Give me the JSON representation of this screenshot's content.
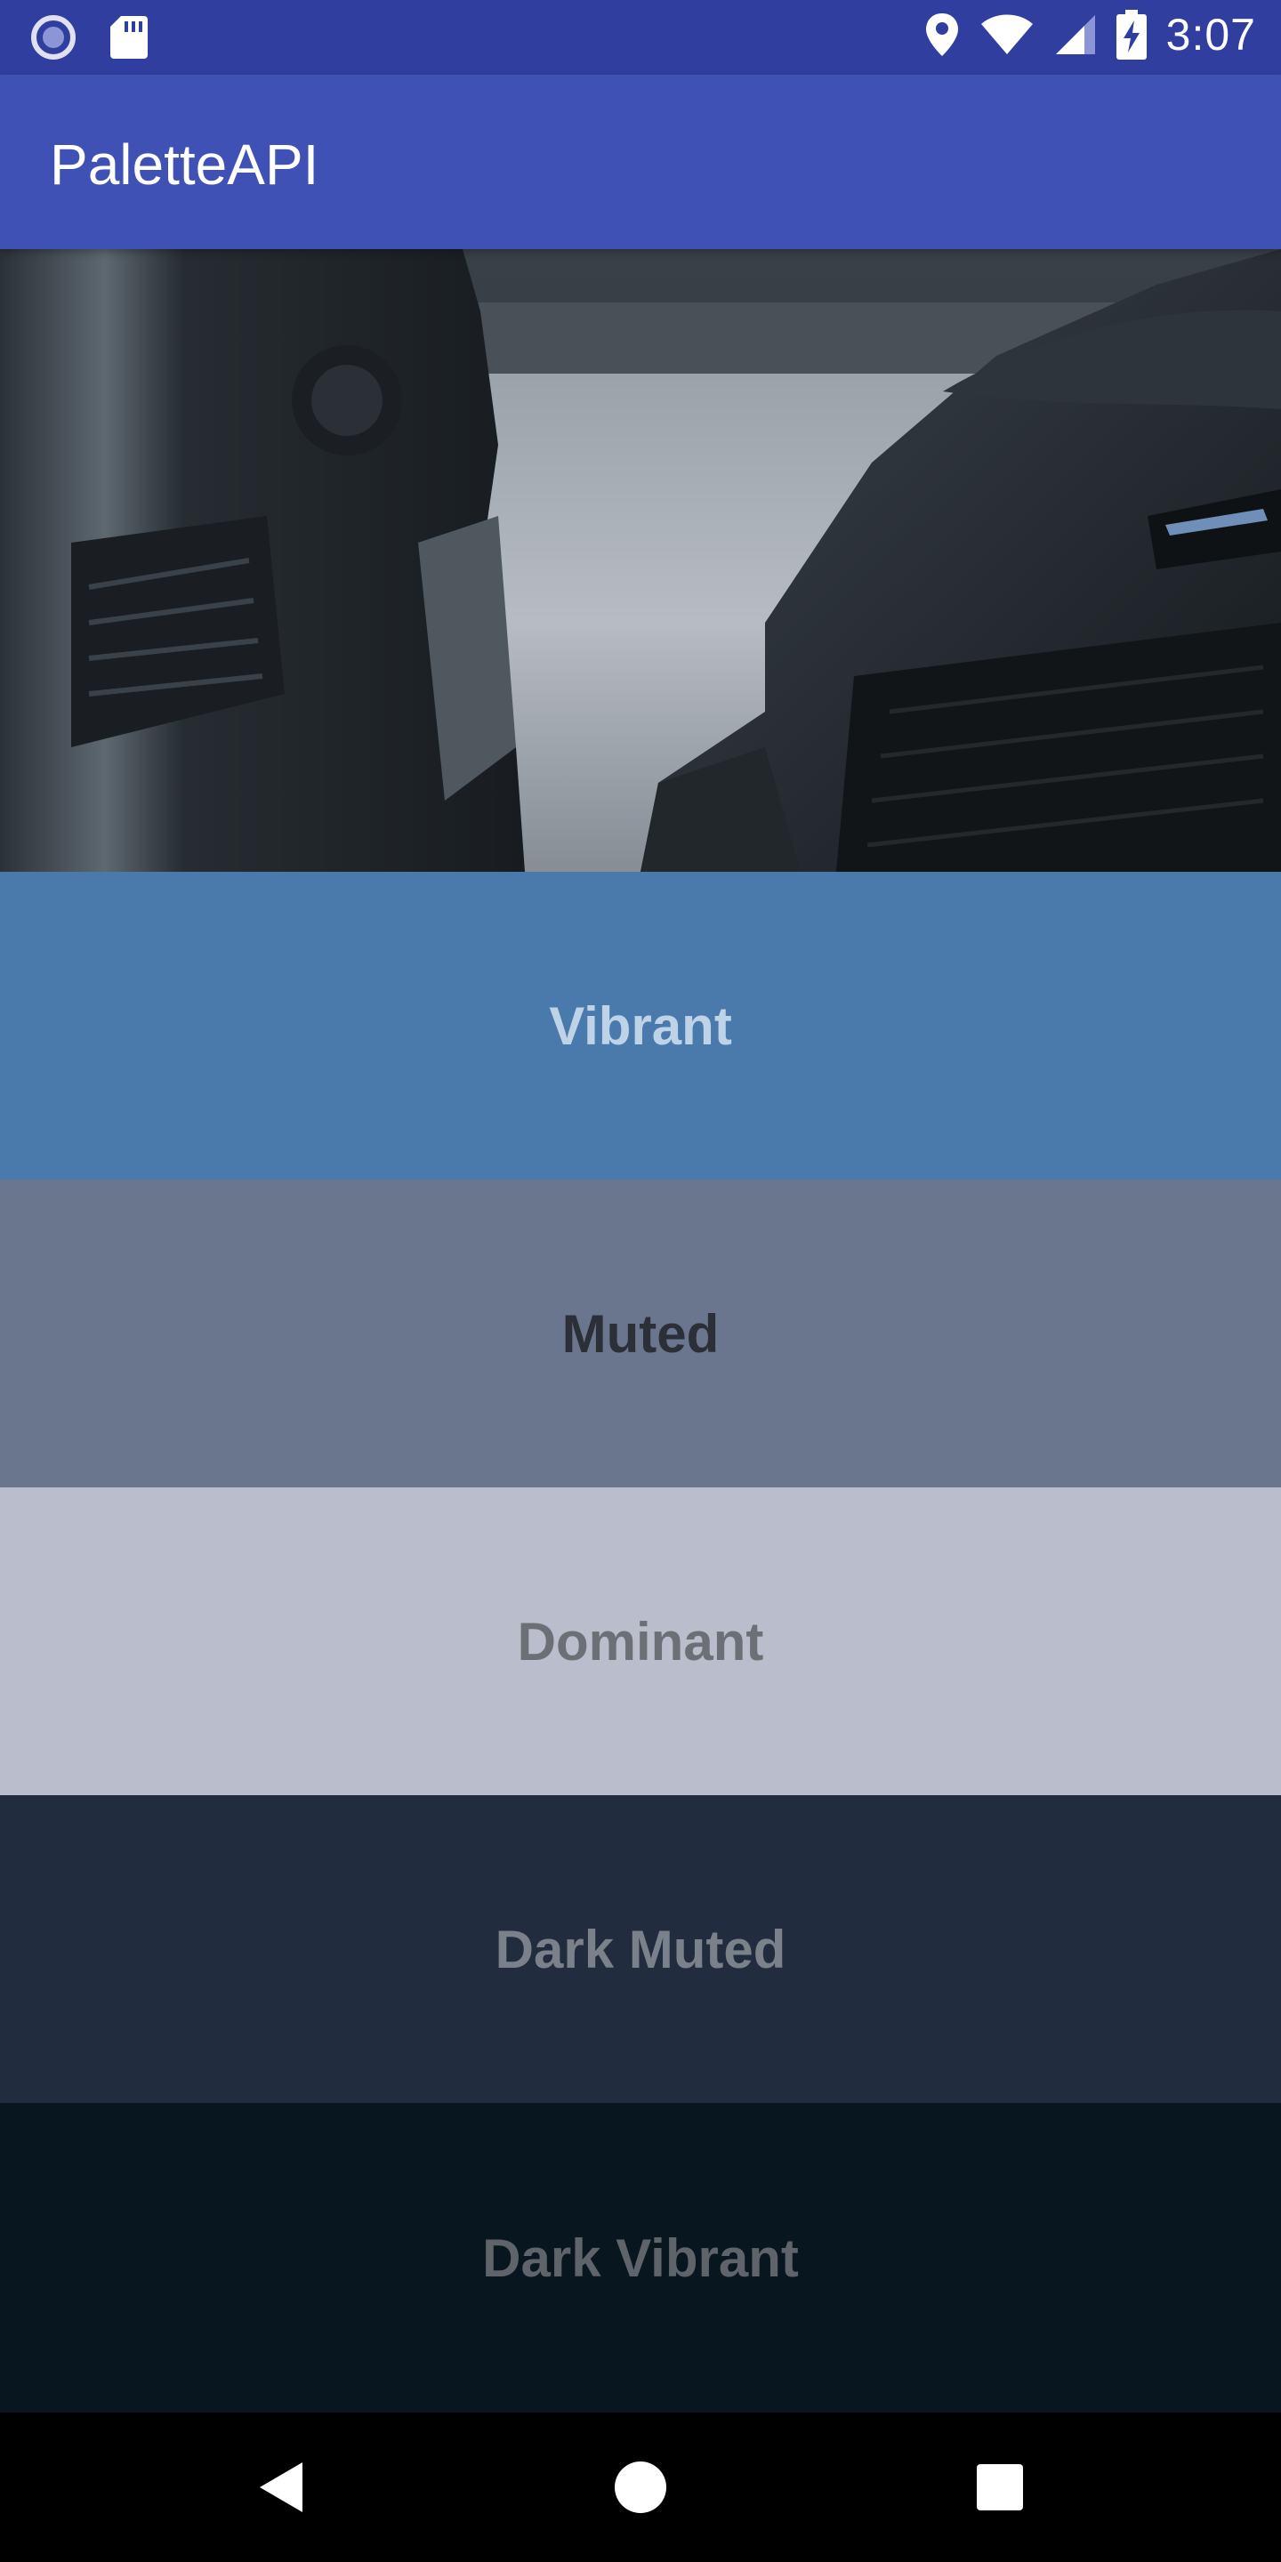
{
  "status_bar": {
    "time": "3:07",
    "icons": [
      "radio-button-icon",
      "sd-card-icon",
      "location-icon",
      "wifi-icon",
      "signal-icon",
      "battery-charging-icon"
    ]
  },
  "app_bar": {
    "title": "PaletteAPI",
    "color": "#3f51b5"
  },
  "hero_image": {
    "description_icon": "car-photo"
  },
  "swatches": [
    {
      "label": "Vibrant",
      "background": "#4a7aab",
      "text_color": "#bfd3e8"
    },
    {
      "label": "Muted",
      "background": "#6a768e",
      "text_color": "#2b2f38"
    },
    {
      "label": "Dominant",
      "background": "#b9bdcc",
      "text_color": "#6d6f77"
    },
    {
      "label": "Dark Muted",
      "background": "#212d3e",
      "text_color": "#7b818a"
    },
    {
      "label": "Dark Vibrant",
      "background": "#08161f",
      "text_color": "#5e6469"
    }
  ],
  "nav_bar": {
    "buttons": [
      "back-icon",
      "home-icon",
      "recents-icon"
    ]
  }
}
